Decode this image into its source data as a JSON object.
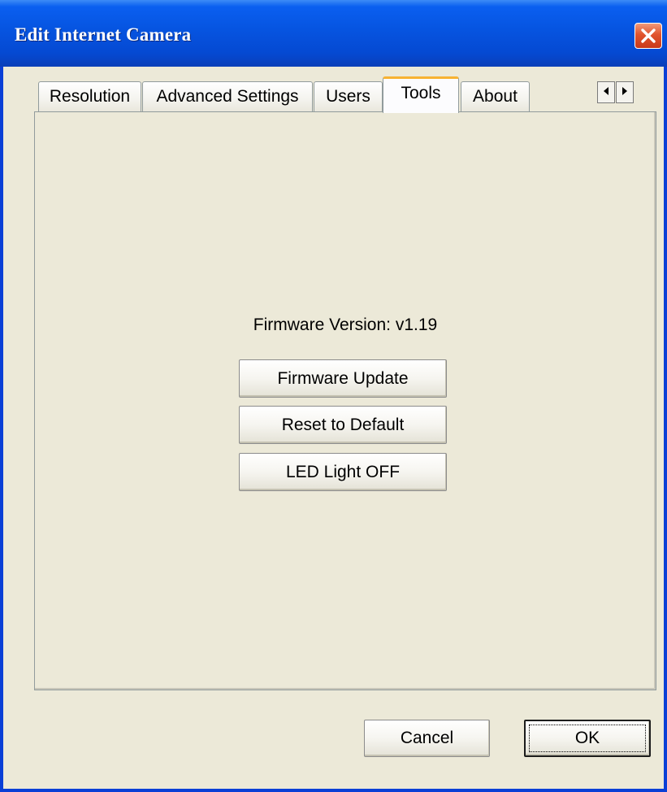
{
  "window": {
    "title": "Edit Internet Camera"
  },
  "tabs": [
    {
      "label": "Resolution",
      "active": false
    },
    {
      "label": "Advanced Settings",
      "active": false
    },
    {
      "label": "Users",
      "active": false
    },
    {
      "label": "Tools",
      "active": true
    },
    {
      "label": "About",
      "active": false
    }
  ],
  "tools_panel": {
    "firmware_version": "Firmware Version: v1.19",
    "buttons": {
      "firmware_update": "Firmware Update",
      "reset_default": "Reset to Default",
      "led_light": "LED Light OFF"
    }
  },
  "dialog_buttons": {
    "cancel": "Cancel",
    "ok": "OK"
  },
  "icons": {
    "close": "close-icon",
    "tab_scroll_left": "arrow-left-icon",
    "tab_scroll_right": "arrow-right-icon"
  },
  "colors": {
    "titlebar": "#0654e0",
    "window_face": "#ece9d8",
    "active_tab_highlight": "#f7b232",
    "close_button": "#e1542d"
  }
}
